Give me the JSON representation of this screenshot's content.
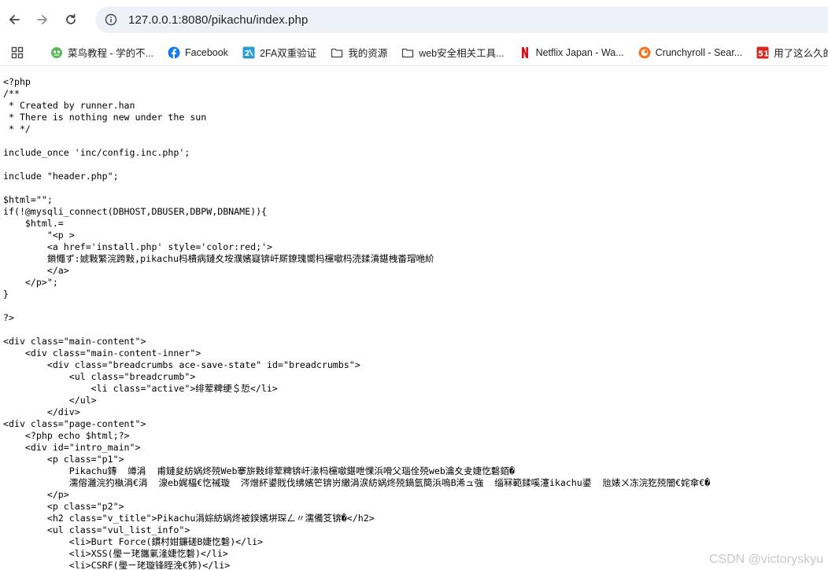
{
  "browser": {
    "url": "127.0.0.1:8080/pikachu/index.php"
  },
  "bookmarks": [
    {
      "label": "菜鸟教程 - 学的不...",
      "icon": "runoob-icon",
      "color": "#5cb85c"
    },
    {
      "label": "Facebook",
      "icon": "facebook-icon",
      "color": "#1877f2"
    },
    {
      "label": "2FA双重验证",
      "icon": "2fa-icon",
      "color": "#2b9ad6"
    },
    {
      "label": "我的资源",
      "icon": "folder-icon",
      "color": "#444746"
    },
    {
      "label": "web安全相关工具...",
      "icon": "folder-icon",
      "color": "#444746"
    },
    {
      "label": "Netflix Japan - Wa...",
      "icon": "netflix-icon",
      "color": "#e50914"
    },
    {
      "label": "Crunchyroll - Sear...",
      "icon": "crunchyroll-icon",
      "color": "#f47521"
    },
    {
      "label": "用了这么久的",
      "icon": "51-icon",
      "color": "#d9251d"
    }
  ],
  "source_lines": [
    "<?php",
    "/**",
    " * Created by runner.han",
    " * There is nothing new under the sun",
    " * */",
    "",
    "include_once 'inc/config.inc.php';",
    "",
    "include \"header.php\";",
    "",
    "$html=\"\";",
    "if(!@mysqli_connect(DBHOST,DBUSER,DBPW,DBNAME)){",
    "    $html.=",
    "        \"<p >",
    "        <a href='install.php' style='color:red;'>",
    "        鎖憴ず:婋敤繁浣跨敤,pikachu杩樻病鏈夊垵濮嬪寲锛屽厛鐐瑰嚮杩欓噷杩涜鍒濆鍖栧畨瑁咃紒",
    "        </a>",
    "    </p>\";",
    "}",
    "",
    "?>",
    "",
    "<div class=\"main-content\">",
    "    <div class=\"main-content-inner\">",
    "        <div class=\"breadcrumbs ace-save-state\" id=\"breadcrumbs\">",
    "            <ul class=\"breadcrumb\">",
    "                <li class=\"active\">绯荤粺绠＄悊</li>",
    "            </ul>",
    "        </div>",
    "<div class=\"page-content\">",
    "    <?php echo $html;?>",
    "    <div id=\"intro_main\">",
    "        <p class=\"p1\">",
    "            Pikachu鏄  竴涓  甫鏈夋紡娲炵殑Web搴旂敤绯荤粺锛屽湪杩欓噷鍖呭惈浜嗗父瑙佺殑web瀹夊叏婕忔礊銆�",
    "            濡傛灉浣犳槸涓€涓  湶eb娓楅€忔祴璇  涔熷紑鍙戝伐绋嬪笀锛岃繖涓涙紡娲炵殑鍋氫簡浜嗚В浠ュ強  缁冧範鍒嗘瀽ikachu鍙  兘婊ㄨ冻浣犵殑闇€姹傘€�",
    "        </p>",
    "        <p class=\"p2\">",
    "        <h2 class=\"v_title\">Pikachu涓婃紡娲炵被鍨嬪垪琛ㄥ〃濡備笅锛�</h2>",
    "        <ul class=\"vul_list_info\">",
    "            <li>Burt Force(鏆村姏鐮磋В婕忔礊)</li>",
    "            <li>XSS(璺ㄧ珯鑴氭湰婕忔礊)</li>",
    "            <li>CSRF(璺ㄧ珯璇锋眰浼€犻)</li>"
  ],
  "watermark": "CSDN @victoryskyu"
}
